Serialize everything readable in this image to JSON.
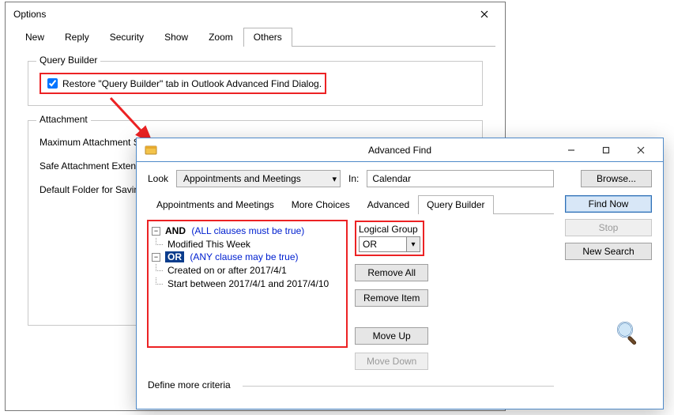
{
  "options": {
    "title": "Options",
    "tabs": [
      "New",
      "Reply",
      "Security",
      "Show",
      "Zoom",
      "Others"
    ],
    "active_tab_index": 5,
    "query_builder": {
      "legend": "Query Builder",
      "checkbox_label": "Restore \"Query Builder\" tab in Outlook Advanced Find Dialog.",
      "checked": true
    },
    "attachment": {
      "legend": "Attachment",
      "rows": [
        "Maximum Attachment Si",
        "Safe Attachment Extens",
        "Default Folder for Savin"
      ]
    }
  },
  "advanced_find": {
    "title": "Advanced Find",
    "look_label": "Look",
    "look_combo": "Appointments and Meetings",
    "in_label": "In:",
    "in_value": "Calendar",
    "browse_btn": "Browse...",
    "tabs": [
      "Appointments and Meetings",
      "More Choices",
      "Advanced",
      "Query Builder"
    ],
    "active_tab_index": 3,
    "buttons": {
      "find_now": "Find Now",
      "stop": "Stop",
      "new_search": "New Search",
      "remove_all": "Remove All",
      "remove_item": "Remove Item",
      "move_up": "Move Up",
      "move_down": "Move Down"
    },
    "logical_group": {
      "label": "Logical Group",
      "value": "OR"
    },
    "tree": {
      "and_kw": "AND",
      "and_desc": "(ALL clauses must be true)",
      "item1": "Modified This Week",
      "or_kw": "OR",
      "or_desc": "(ANY clause may be true)",
      "item2": "Created on or after 2017/4/1",
      "item3": "Start between 2017/4/1 and 2017/4/10"
    },
    "define_more": "Define more criteria"
  }
}
